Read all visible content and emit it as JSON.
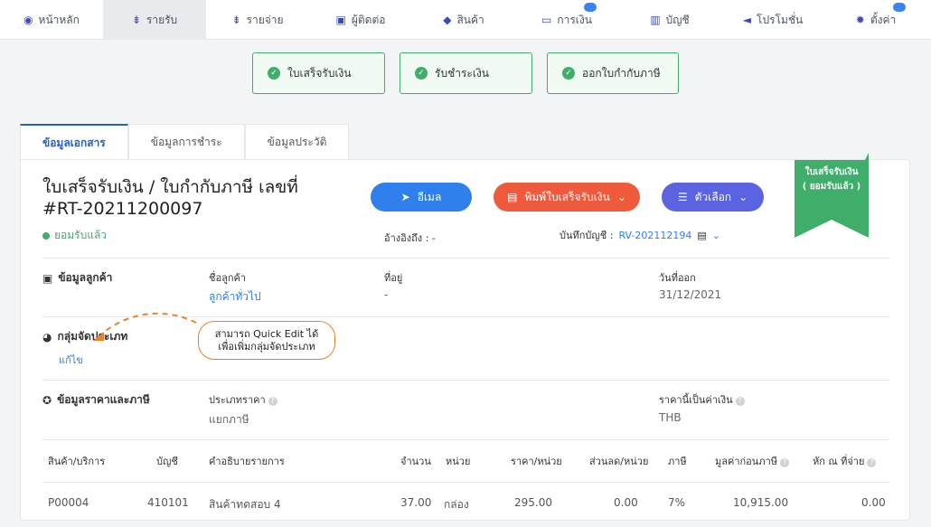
{
  "nav": [
    {
      "label": "หน้าหลัก",
      "icon": "dashboard-icon",
      "glyph": "◉",
      "active": false,
      "badge": false
    },
    {
      "label": "รายรับ",
      "icon": "income-icon",
      "glyph": "⇟",
      "active": true,
      "badge": false
    },
    {
      "label": "รายจ่าย",
      "icon": "expense-icon",
      "glyph": "⇟",
      "active": false,
      "badge": false
    },
    {
      "label": "ผู้ติดต่อ",
      "icon": "contacts-icon",
      "glyph": "▣",
      "active": false,
      "badge": false
    },
    {
      "label": "สินค้า",
      "icon": "product-box-icon",
      "glyph": "◆",
      "active": false,
      "badge": false
    },
    {
      "label": "การเงิน",
      "icon": "money-icon",
      "glyph": "▭",
      "active": false,
      "badge": true
    },
    {
      "label": "บัญชี",
      "icon": "ledger-icon",
      "glyph": "▥",
      "active": false,
      "badge": false
    },
    {
      "label": "โปรโมชั่น",
      "icon": "megaphone-icon",
      "glyph": "◄",
      "active": false,
      "badge": false
    },
    {
      "label": "ตั้งค่า",
      "icon": "gear-icon",
      "glyph": "✹",
      "active": false,
      "badge": true
    }
  ],
  "steps": [
    "ใบเสร็จรับเงิน",
    "รับชำระเงิน",
    "ออกใบกำกับภาษี"
  ],
  "tabs": [
    "ข้อมูลเอกสาร",
    "ข้อมูลการชำระ",
    "ข้อมูลประวัติ"
  ],
  "doc": {
    "title": "ใบเสร็จรับเงิน / ใบกำกับภาษี เลขที่ #RT-20211200097",
    "status": "ยอมรับแล้ว",
    "email_label": "อีเมล",
    "print_label": "พิมพ์ใบเสร็จรับเงิน",
    "options_label": "ตัวเลือก",
    "reference": "อ้างอิงถึง : -",
    "booked_label": "บันทึกบัญชี :",
    "booked_value": "RV-202112194",
    "ribbon_line1": "ใบเสร็จรับเงิน",
    "ribbon_line2": "( ยอมรับแล้ว )",
    "accent_green": "#3fae6a"
  },
  "customer": {
    "section": "ข้อมูลลูกค้า",
    "name_label": "ชื่อลูกค้า",
    "name_value": "ลูกค้าทั่วไป",
    "address_label": "ที่อยู่",
    "address_value": "-",
    "date_label": "วันที่ออก",
    "date_value": "31/12/2021"
  },
  "category": {
    "section": "กลุ่มจัดประเภท",
    "edit": "แก้ไข",
    "callout_line1": "สามารถ Quick Edit ได้",
    "callout_line2": "เพื่อเพิ่มกลุ่มจัดประเภท"
  },
  "pricing": {
    "section": "ข้อมูลราคาและภาษี",
    "price_type_label": "ประเภทราคา",
    "price_type_value": "แยกภาษี",
    "currency_label": "ราคานี้เป็นค่าเงิน",
    "currency_value": "THB"
  },
  "table": {
    "headers": [
      "สินค้า/บริการ",
      "บัญชี",
      "คำอธิบายรายการ",
      "จำนวน",
      "หน่วย",
      "ราคา/หน่วย",
      "ส่วนลด/หน่วย",
      "ภาษี",
      "มูลค่าก่อนภาษี",
      "หัก ณ ที่จ่าย"
    ],
    "rows": [
      [
        "P00004",
        "410101",
        "สินค้าทดสอบ 4",
        "37.00",
        "กล่อง",
        "295.00",
        "0.00",
        "7%",
        "10,915.00",
        "0.00"
      ]
    ]
  }
}
